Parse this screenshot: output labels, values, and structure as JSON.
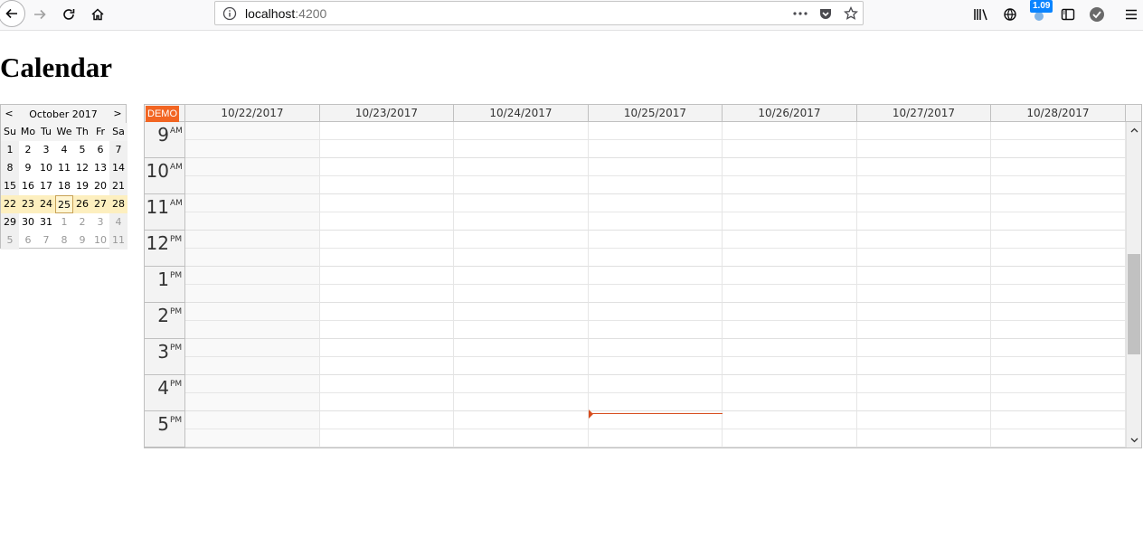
{
  "browser": {
    "url_host": "localhost",
    "url_port": ":4200",
    "extension_badge": "1.09"
  },
  "page": {
    "title": "Calendar"
  },
  "navigator": {
    "month_title": "October 2017",
    "prev_label": "<",
    "next_label": ">",
    "day_names": [
      "Su",
      "Mo",
      "Tu",
      "We",
      "Th",
      "Fr",
      "Sa"
    ],
    "weeks": [
      [
        "1",
        "2",
        "3",
        "4",
        "5",
        "6",
        "7"
      ],
      [
        "8",
        "9",
        "10",
        "11",
        "12",
        "13",
        "14"
      ],
      [
        "15",
        "16",
        "17",
        "18",
        "19",
        "20",
        "21"
      ],
      [
        "22",
        "23",
        "24",
        "25",
        "26",
        "27",
        "28"
      ],
      [
        "29",
        "30",
        "31",
        "1",
        "2",
        "3",
        "4"
      ],
      [
        "5",
        "6",
        "7",
        "8",
        "9",
        "10",
        "11"
      ]
    ],
    "selected_week_index": 3,
    "today_label": "25"
  },
  "scheduler": {
    "corner_label": "DEMO",
    "columns": [
      "10/22/2017",
      "10/23/2017",
      "10/24/2017",
      "10/25/2017",
      "10/26/2017",
      "10/27/2017",
      "10/28/2017"
    ],
    "hours": [
      {
        "num": "9",
        "suffix": "AM"
      },
      {
        "num": "10",
        "suffix": "AM"
      },
      {
        "num": "11",
        "suffix": "AM"
      },
      {
        "num": "12",
        "suffix": "PM"
      },
      {
        "num": "1",
        "suffix": "PM"
      },
      {
        "num": "2",
        "suffix": "PM"
      },
      {
        "num": "3",
        "suffix": "PM"
      },
      {
        "num": "4",
        "suffix": "PM"
      },
      {
        "num": "5",
        "suffix": "PM"
      }
    ],
    "current_time_indicator_color": "#d74d1e",
    "corner_color": "#f26522"
  }
}
